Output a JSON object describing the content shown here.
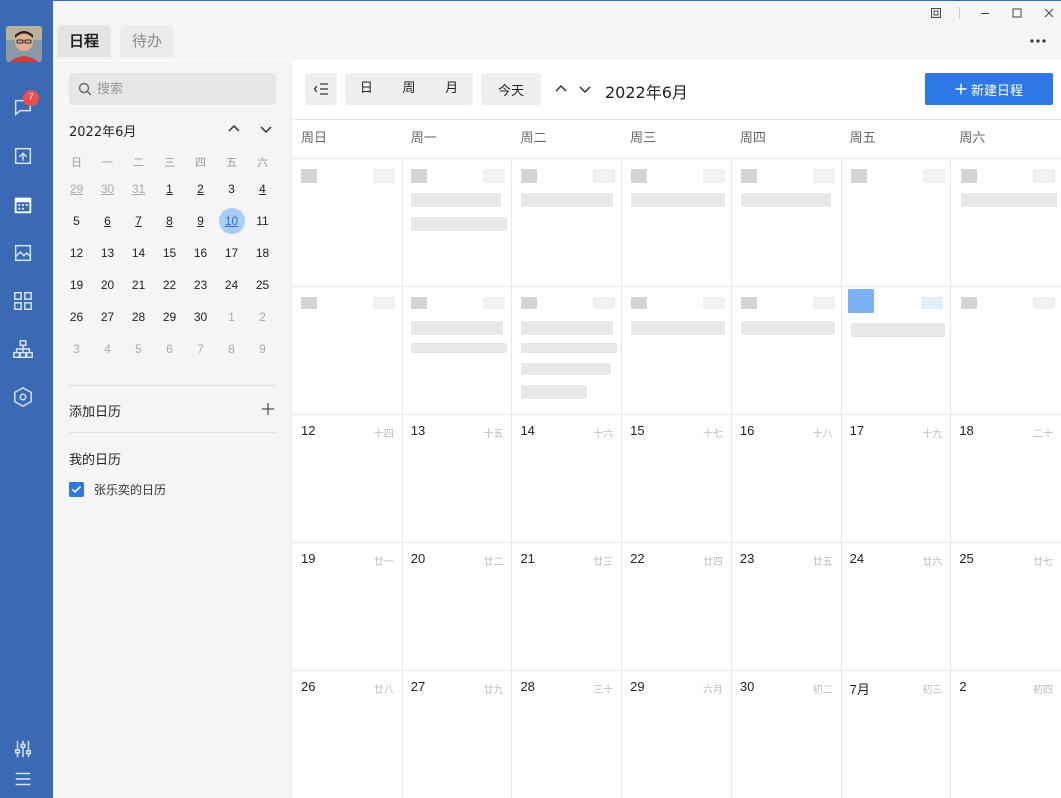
{
  "nav": {
    "badge_count": "7",
    "items": [
      "chat-icon",
      "cube-icon",
      "calendar-icon",
      "image-icon",
      "apps-icon",
      "org-icon",
      "hexagon-icon"
    ],
    "bottom": [
      "settings-sliders-icon",
      "menu-icon"
    ]
  },
  "header": {
    "tabs": [
      {
        "label": "日程"
      },
      {
        "label": "待办"
      }
    ]
  },
  "sidebar": {
    "search_placeholder": "搜索",
    "mini_title": "2022年6月",
    "weekdays": [
      "日",
      "一",
      "二",
      "三",
      "四",
      "五",
      "六"
    ],
    "weeks": [
      [
        {
          "d": "29",
          "o": true,
          "m": true
        },
        {
          "d": "30",
          "o": true,
          "m": true
        },
        {
          "d": "31",
          "o": true,
          "m": true
        },
        {
          "d": "1",
          "m": true
        },
        {
          "d": "2",
          "m": true
        },
        {
          "d": "3"
        },
        {
          "d": "4",
          "m": true
        }
      ],
      [
        {
          "d": "5"
        },
        {
          "d": "6",
          "m": true
        },
        {
          "d": "7",
          "m": true
        },
        {
          "d": "8",
          "m": true
        },
        {
          "d": "9",
          "m": true
        },
        {
          "d": "10",
          "t": true,
          "m": true
        },
        {
          "d": "11"
        }
      ],
      [
        {
          "d": "12"
        },
        {
          "d": "13"
        },
        {
          "d": "14"
        },
        {
          "d": "15"
        },
        {
          "d": "16"
        },
        {
          "d": "17"
        },
        {
          "d": "18"
        }
      ],
      [
        {
          "d": "19"
        },
        {
          "d": "20"
        },
        {
          "d": "21"
        },
        {
          "d": "22"
        },
        {
          "d": "23"
        },
        {
          "d": "24"
        },
        {
          "d": "25"
        }
      ],
      [
        {
          "d": "26"
        },
        {
          "d": "27"
        },
        {
          "d": "28"
        },
        {
          "d": "29"
        },
        {
          "d": "30"
        },
        {
          "d": "1",
          "o": true
        },
        {
          "d": "2",
          "o": true
        }
      ],
      [
        {
          "d": "3",
          "o": true
        },
        {
          "d": "4",
          "o": true
        },
        {
          "d": "5",
          "o": true
        },
        {
          "d": "6",
          "o": true
        },
        {
          "d": "7",
          "o": true
        },
        {
          "d": "8",
          "o": true
        },
        {
          "d": "9",
          "o": true
        }
      ]
    ],
    "add_calendar_label": "添加日历",
    "my_calendars_label": "我的日历",
    "calendars": [
      {
        "label": "张乐奕的日历",
        "checked": true
      }
    ]
  },
  "toolbar": {
    "views": [
      "日",
      "周",
      "月"
    ],
    "today_label": "今天",
    "current_month": "2022年6月",
    "new_event_label": "新建日程"
  },
  "calendar": {
    "weekday_headers": [
      "周日",
      "周一",
      "周二",
      "周三",
      "周四",
      "周五",
      "周六"
    ],
    "weeks": [
      [
        {
          "d": "",
          "l": ""
        },
        {
          "d": "",
          "l": ""
        },
        {
          "d": "",
          "l": ""
        },
        {
          "d": "",
          "l": ""
        },
        {
          "d": "",
          "l": ""
        },
        {
          "d": "",
          "l": ""
        },
        {
          "d": "",
          "l": ""
        }
      ],
      [
        {
          "d": "",
          "l": ""
        },
        {
          "d": "",
          "l": ""
        },
        {
          "d": "",
          "l": ""
        },
        {
          "d": "",
          "l": ""
        },
        {
          "d": "",
          "l": ""
        },
        {
          "d": "",
          "l": ""
        },
        {
          "d": "",
          "l": ""
        }
      ],
      [
        {
          "d": "12",
          "l": "十四"
        },
        {
          "d": "13",
          "l": "十五"
        },
        {
          "d": "14",
          "l": "十六"
        },
        {
          "d": "15",
          "l": "十七"
        },
        {
          "d": "16",
          "l": "十八"
        },
        {
          "d": "17",
          "l": "十九"
        },
        {
          "d": "18",
          "l": "二十"
        }
      ],
      [
        {
          "d": "19",
          "l": "廿一"
        },
        {
          "d": "20",
          "l": "廿二"
        },
        {
          "d": "21",
          "l": "廿三"
        },
        {
          "d": "22",
          "l": "廿四"
        },
        {
          "d": "23",
          "l": "廿五"
        },
        {
          "d": "24",
          "l": "廿六"
        },
        {
          "d": "25",
          "l": "廿七"
        }
      ],
      [
        {
          "d": "26",
          "l": "廿八"
        },
        {
          "d": "27",
          "l": "廿九"
        },
        {
          "d": "28",
          "l": "三十"
        },
        {
          "d": "29",
          "l": "六月"
        },
        {
          "d": "30",
          "l": "初二"
        },
        {
          "d": "7月",
          "l": "初三"
        },
        {
          "d": "2",
          "l": "初四"
        }
      ]
    ]
  }
}
